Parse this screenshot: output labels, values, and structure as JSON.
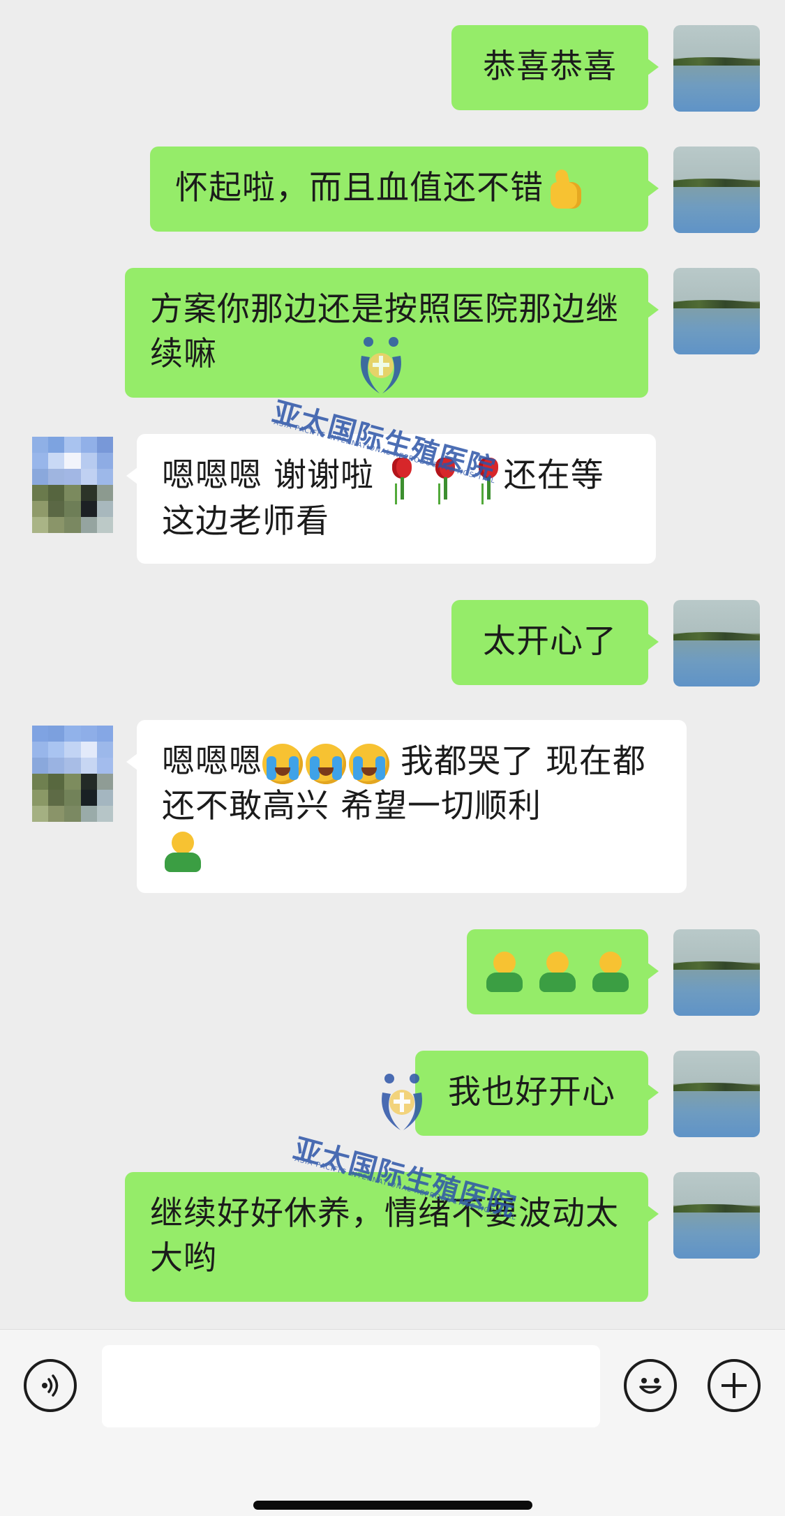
{
  "messages": [
    {
      "side": "me",
      "text": "恭喜恭喜"
    },
    {
      "side": "me",
      "text": "怀起啦，而且血值还不错",
      "emoji": "thumbs-up"
    },
    {
      "side": "me",
      "text": "方案你那边还是按照医院那边继续嘛"
    },
    {
      "side": "other",
      "text_a": "嗯嗯嗯   谢谢啦 ",
      "emoji": "rose",
      "text_b": "还在等这边老师看"
    },
    {
      "side": "me",
      "text": "太开心了"
    },
    {
      "side": "other",
      "text_a": "嗯嗯嗯",
      "emoji_a": "loudly-crying-face",
      "text_b": "   我都哭了   现在都还不敢高兴   希望一切顺利",
      "emoji_b": "person-figure"
    },
    {
      "side": "me",
      "emoji": "person-figure"
    },
    {
      "side": "me",
      "text": "我也好开心"
    },
    {
      "side": "me",
      "text": "继续好好休养，情绪不要波动太大哟"
    }
  ],
  "watermark": {
    "name": "亚太国际生殖医院",
    "subtitle": "ASIA PACIFIC INTERNATIONAL REPRODUCTIVE HOSPITAL",
    "color": "#2d55a8"
  },
  "input_bar": {
    "voice_icon": "voice-icon",
    "emoji_icon": "smiley-icon",
    "plus_icon": "plus-icon"
  },
  "colors": {
    "background": "#ededed",
    "my_bubble": "#95ec69",
    "their_bubble": "#ffffff"
  }
}
